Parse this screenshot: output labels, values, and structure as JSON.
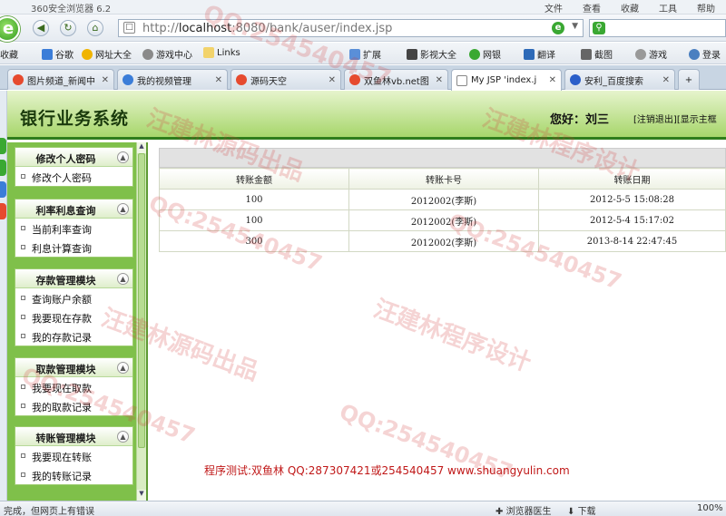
{
  "browser": {
    "title": "360安全浏览器 6.2",
    "menus": [
      "文件",
      "查看",
      "收藏",
      "工具",
      "帮助"
    ],
    "address": {
      "host": "localhost",
      "rest": ":8080/bank/auser/index.jsp",
      "prefix": "http://"
    },
    "bookmarks": [
      "收藏",
      "谷歌",
      "网址大全",
      "游戏中心",
      "Links",
      "扩展",
      "影视大全",
      "网银",
      "翻译",
      "截图",
      "游戏",
      "登录"
    ],
    "tabs": [
      {
        "label": "图片频道_新闻中",
        "active": false
      },
      {
        "label": "我的视频管理",
        "active": false
      },
      {
        "label": "源码天空",
        "active": false
      },
      {
        "label": "双鱼林vb.net图",
        "active": false
      },
      {
        "label": "My JSP 'index.j",
        "active": true
      },
      {
        "label": "安利_百度搜索",
        "active": false
      }
    ],
    "status": {
      "left": "完成，但网页上有错误",
      "right": [
        "浏览器医生",
        "下载",
        "100%"
      ]
    }
  },
  "header": {
    "system_title": "银行业务系统",
    "greeting": "您好：刘三",
    "logout": "[注销退出]",
    "show": "[显示主框"
  },
  "menu": [
    {
      "title": "修改个人密码",
      "items": [
        "修改个人密码"
      ]
    },
    {
      "title": "利率利息查询",
      "items": [
        "当前利率查询",
        "利息计算查询"
      ]
    },
    {
      "title": "存款管理模块",
      "items": [
        "查询账户余额",
        "我要现在存款",
        "我的存款记录"
      ]
    },
    {
      "title": "取款管理模块",
      "items": [
        "我要现在取款",
        "我的取款记录"
      ]
    },
    {
      "title": "转账管理模块",
      "items": [
        "我要现在转账",
        "我的转账记录"
      ]
    }
  ],
  "table": {
    "headers": [
      "转账金额",
      "转账卡号",
      "转账日期"
    ],
    "rows": [
      [
        "100",
        "2012002(李斯)",
        "2012-5-5 15:08:28"
      ],
      [
        "100",
        "2012002(李斯)",
        "2012-5-4 15:17:02"
      ],
      [
        "300",
        "2012002(李斯)",
        "2013-8-14 22:47:45"
      ]
    ]
  },
  "credit": "程序测试:双鱼林 QQ:287307421或254540457 www.shuangyulin.com",
  "watermarks": [
    "汪建林源码出品",
    "汪建林程序设计",
    "QQ:254540457"
  ]
}
